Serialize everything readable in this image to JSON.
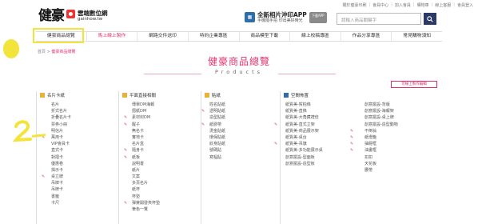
{
  "top_links": [
    "關於健豪印刷",
    "會員中心",
    "加入會員",
    "購物車",
    "線上客服",
    "會員登入"
  ],
  "logo": {
    "brush": "健豪",
    "cn": "雲端數位網",
    "en": "gainhow.tw"
  },
  "promo": {
    "title": "全新相片沖印APP",
    "subtitle": "手機隨手拍  印出美好時光",
    "badge": "下載APP"
  },
  "search": {
    "placeholder": "請輸入商品關鍵字"
  },
  "nav": [
    "健豪商品總覽",
    "馬上線上製作",
    "網路交件送印",
    "特約企業專區",
    "商品模型下載",
    "線上校稿專區",
    "作品分享專區",
    "常見購物須知"
  ],
  "breadcrumb": {
    "home": "首頁",
    "current": "健豪商品總覽"
  },
  "heading": {
    "zh": "健豪商品總覽",
    "en": "Products"
  },
  "legend": "可線上製作編輯",
  "columns": [
    {
      "title": "名片卡紙",
      "items": [
        "名片",
        "折式名片",
        "折疊名片卡",
        "票券小冊",
        "明信片",
        "萬用卡",
        "VIP會員卡",
        "直式卡",
        "對摺卡",
        "優惠卷",
        "揭示卡",
        "桌立牌",
        "吊牌卡",
        "吊牌卡",
        "書籤",
        "卡尺"
      ],
      "pens": [
        5,
        11
      ]
    },
    {
      "title": "平面直接相關",
      "items": [
        "傳單DM海報",
        "摺紙DM",
        "素材封DM",
        "醒子",
        "無名卡",
        "實地卡",
        "名片盒",
        "隨身卡",
        "紙板",
        "說明書",
        "紙片",
        "文案",
        "多頁名片",
        "紙杯",
        "杯墊",
        "彈簧開發夾杯墊",
        "筆色一覽"
      ],
      "pens": [
        2,
        3,
        7,
        8,
        15
      ]
    },
    {
      "title": "貼紙",
      "items": [
        "姓名貼紙",
        "透明貼紙",
        "造型貼紙",
        "紙膠帶",
        "燙金貼紙",
        "環保貼紙",
        "紋身貼紙",
        "號碼貼",
        "寫幅貼"
      ],
      "pens": [
        1,
        3
      ]
    },
    {
      "title": "空間佈置",
      "items": [
        "紙質美-賀柏條",
        "紙質美-直條",
        "紙質美-大角藏禮佳",
        "紙質美-直式立架",
        "紙質美-商品展示架",
        "紙質美-桌台",
        "紙質美-吊旗",
        "紙質美-多功能展示桌",
        "創意擺設-型面板",
        "創意擺設-造型板"
      ],
      "pens": [
        3,
        6
      ]
    },
    {
      "title": "",
      "items": [
        "創意擺設-背版",
        "創意擺設-海報架",
        "創意擺設-桌上牌",
        "創意擺設-造型動物",
        "不倒翁",
        "紙燈籠",
        "抽屜框",
        "油畫框",
        "扣扣",
        "天花板",
        "腰帶"
      ],
      "pens": [
        4,
        5,
        6,
        7
      ]
    }
  ]
}
